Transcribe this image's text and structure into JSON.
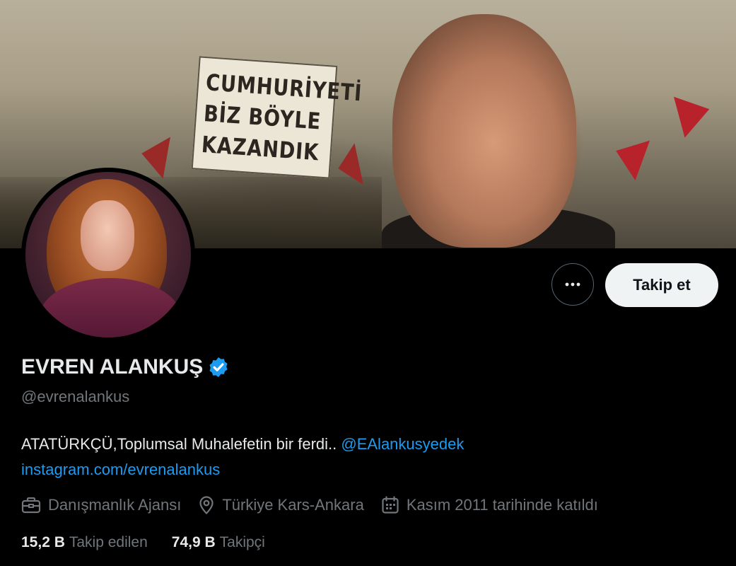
{
  "banner": {
    "sign_lines": [
      "CUMHURİYETİ",
      "BİZ BÖYLE",
      "KAZANDIK"
    ]
  },
  "profile": {
    "name": "EVREN ALANKUŞ",
    "handle": "@evrenalankus",
    "bio_text": "ATATÜRKÇÜ,Toplumsal Muhalefetin bir ferdi.. ",
    "bio_mention": "@EAlankusyedek",
    "bio_link": "instagram.com/evrenalankus",
    "category": "Danışmanlık Ajansı",
    "location": "Türkiye Kars-Ankara",
    "joined": "Kasım 2011 tarihinde katıldı"
  },
  "actions": {
    "follow_label": "Takip et"
  },
  "stats": {
    "following_count": "15,2 B",
    "following_label": "Takip edilen",
    "followers_count": "74,9 B",
    "followers_label": "Takipçi"
  },
  "colors": {
    "background": "#000000",
    "text_primary": "#e7e9ea",
    "text_secondary": "#71767b",
    "link": "#1d9bf0",
    "verified": "#1d9bf0",
    "follow_button_bg": "#eff3f4"
  }
}
